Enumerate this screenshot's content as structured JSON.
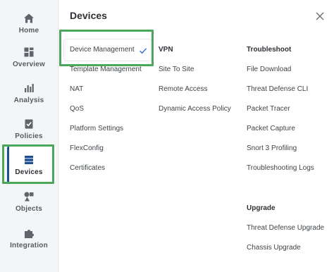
{
  "sidebar": {
    "items": [
      {
        "label": "Home",
        "icon": "home-icon"
      },
      {
        "label": "Overview",
        "icon": "dashboard-icon"
      },
      {
        "label": "Analysis",
        "icon": "bar-chart-icon"
      },
      {
        "label": "Policies",
        "icon": "policy-checklist-icon"
      },
      {
        "label": "Devices",
        "icon": "server-stack-icon",
        "active": true
      },
      {
        "label": "Objects",
        "icon": "shapes-icon"
      },
      {
        "label": "Integration",
        "icon": "puzzle-icon"
      }
    ]
  },
  "panel": {
    "title": "Devices",
    "close_icon": "close-icon"
  },
  "columns": {
    "col1": {
      "items": [
        "Device Management",
        "Template Management",
        "NAT",
        "QoS",
        "Platform Settings",
        "FlexConfig",
        "Certificates"
      ],
      "selected_icon": "checkmark-icon"
    },
    "vpn": {
      "heading": "VPN",
      "items": [
        "Site To Site",
        "Remote Access",
        "Dynamic Access Policy"
      ]
    },
    "troubleshoot": {
      "heading": "Troubleshoot",
      "items": [
        "File Download",
        "Threat Defense CLI",
        "Packet Tracer",
        "Packet Capture",
        "Snort 3 Profiling",
        "Troubleshooting Logs"
      ]
    },
    "upgrade": {
      "heading": "Upgrade",
      "items": [
        "Threat Defense Upgrade",
        "Chassis Upgrade"
      ]
    }
  },
  "colors": {
    "highlight_green": "#4aa85b",
    "active_accent": "#1d4f91",
    "check_blue": "#2a6fd6"
  }
}
